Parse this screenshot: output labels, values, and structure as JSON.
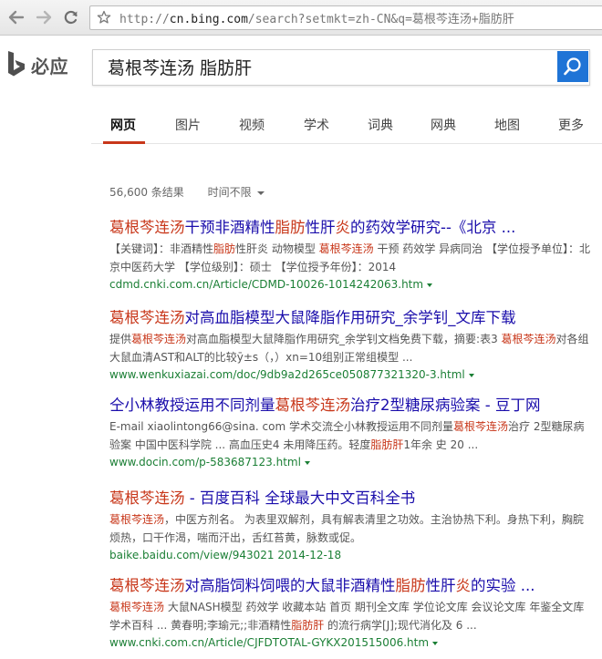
{
  "browser": {
    "back_icon": "back-arrow-icon",
    "forward_icon": "forward-arrow-icon",
    "reload_icon": "reload-icon",
    "bookmark_icon": "star-icon",
    "url_proto": "http://",
    "url_host": "cn.bing.com",
    "url_rest": "/search?setmkt=zh-CN&q=葛根芩连汤+脂肪肝"
  },
  "logo": {
    "text": "必应"
  },
  "search": {
    "query": "葛根芩连汤 脂肪肝",
    "button_icon": "search-icon"
  },
  "tabs": [
    "网页",
    "图片",
    "视频",
    "学术",
    "词典",
    "网典",
    "地图",
    "更多"
  ],
  "meta": {
    "count": "56,600 条结果",
    "time_filter": "时间不限"
  },
  "colors": {
    "link": "#1a0dab",
    "highlight": "#c8371a",
    "url": "#1b7f35",
    "accent": "#1f74d6"
  },
  "results": [
    {
      "title": [
        {
          "t": "葛根芩连汤",
          "h": true
        },
        {
          "t": "干预非酒精性",
          "h": false
        },
        {
          "t": "脂肪",
          "h": true
        },
        {
          "t": "性肝",
          "h": false
        },
        {
          "t": "炎",
          "h": true
        },
        {
          "t": "的药效学研究--《北京 ...",
          "h": false
        }
      ],
      "snippet": [
        {
          "t": "【关键词】：非酒精性",
          "h": false
        },
        {
          "t": "脂肪",
          "h": true
        },
        {
          "t": "性肝炎 动物模型 ",
          "h": false
        },
        {
          "t": "葛根芩连汤",
          "h": true
        },
        {
          "t": " 干预 药效学 异病同治 【学位授予单位】：北京中医药大学 【学位级别】：硕士 【学位授予年份】：2014",
          "h": false
        }
      ],
      "url": "cdmd.cnki.com.cn/Article/CDMD-10026-1014242063.htm"
    },
    {
      "title": [
        {
          "t": "葛根芩连汤",
          "h": true
        },
        {
          "t": "对高血脂模型大鼠降脂作用研究_余学钊_文库下载",
          "h": false
        }
      ],
      "snippet": [
        {
          "t": "提供",
          "h": false
        },
        {
          "t": "葛根芩连汤",
          "h": true
        },
        {
          "t": "对高血脂模型大鼠降脂作用研究_余学钊文档免费下载，摘要:表3 ",
          "h": false
        },
        {
          "t": "葛根芩连汤",
          "h": true
        },
        {
          "t": "对各组大鼠血清AST和ALT的比较",
          "h": false
        },
        {
          "t": "ȳ",
          "h": false
        },
        {
          "t": "±s（，）xn=10组别正常组模型 ...",
          "h": false
        }
      ],
      "url": "www.wenkuxiazai.com/doc/9db9a2d265ce050877321320-3.html"
    },
    {
      "title": [
        {
          "t": "仝小林教授运用不同剂量",
          "h": false
        },
        {
          "t": "葛根芩连汤",
          "h": true
        },
        {
          "t": "治疗2型糖尿病验案 - 豆丁网",
          "h": false
        }
      ],
      "snippet": [
        {
          "t": "E-mail xiaolintong66@sina. com 学术交流仝小林教授运用不同剂量",
          "h": false
        },
        {
          "t": "葛根芩连汤",
          "h": true
        },
        {
          "t": "治疗 2型糖尿病验案 中国中医科学院 ... 高血压史4 未用降压药。轻度",
          "h": false
        },
        {
          "t": "脂肪肝",
          "h": true
        },
        {
          "t": "1年余 史 20 ...",
          "h": false
        }
      ],
      "url": "www.docin.com/p-583687123.html"
    },
    {
      "title": [
        {
          "t": "葛根芩连汤",
          "h": true
        },
        {
          "t": " - 百度百科 全球最大中文百科全书",
          "h": false
        }
      ],
      "snippet": [
        {
          "t": "葛根芩连汤",
          "h": true
        },
        {
          "t": "，中医方剂名。 为表里双解剂，具有解表清里之功效。主治协热下利。身热下利，胸脘烦热，口干作渴，喘而汗出，舌红苔黄，脉数或促。",
          "h": false
        }
      ],
      "url": "baike.baidu.com/view/943021 2014-12-18"
    },
    {
      "title": [
        {
          "t": "葛根芩连汤",
          "h": true
        },
        {
          "t": "对高脂饲料饲喂的大鼠非酒精性",
          "h": false
        },
        {
          "t": "脂肪",
          "h": true
        },
        {
          "t": "性肝",
          "h": false
        },
        {
          "t": "炎",
          "h": true
        },
        {
          "t": "的实验 ...",
          "h": false
        }
      ],
      "snippet": [
        {
          "t": "葛根芩连汤",
          "h": true
        },
        {
          "t": " 大鼠NASH模型 药效学 收藏本站 首页 期刊全文库 学位论文库 会议论文库 年鉴全文库 学术百科 ... 黄春明;李瑜元;;非酒精性",
          "h": false
        },
        {
          "t": "脂肪肝",
          "h": true
        },
        {
          "t": " 的流行病学[J];现代消化及 6 ...",
          "h": false
        }
      ],
      "url": "www.cnki.com.cn/Article/CJFDTOTAL-GYKX201515006.htm"
    }
  ]
}
